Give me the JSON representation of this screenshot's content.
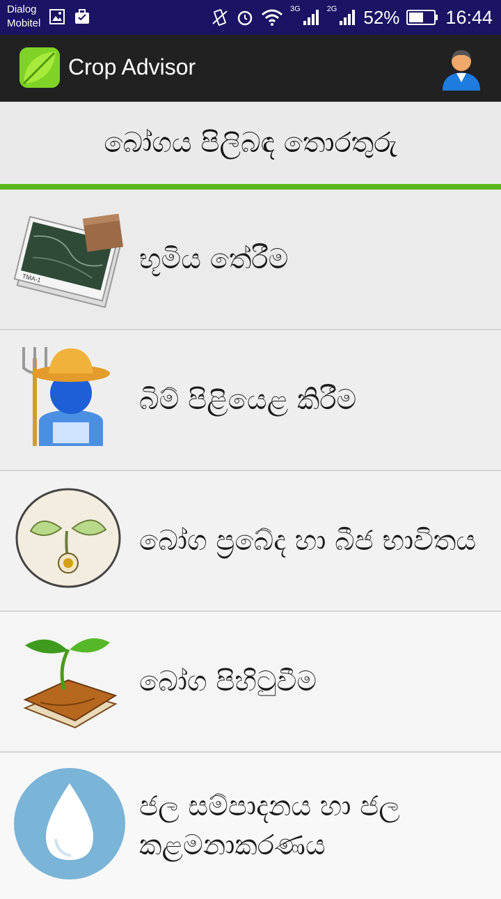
{
  "status_bar": {
    "carrier_line1": "Dialog",
    "carrier_line2": "Mobitel",
    "net1": "3G",
    "net2": "2G",
    "battery": "52%",
    "time": "16:44"
  },
  "app_bar": {
    "title": "Crop Advisor",
    "accent": "#6fc21f"
  },
  "section": {
    "title": "බෝගය පිලිබඳ තොරතුරු",
    "rule_color": "#5cb81a"
  },
  "menu": {
    "items": [
      {
        "label": "භූමිය තේරීම",
        "icon": "soil-sample-icon"
      },
      {
        "label": "බිම් පිළියෙළ කිරීම",
        "icon": "farmer-icon"
      },
      {
        "label": "බෝග ප්‍රබේද හා බීජ භාවිතය",
        "icon": "seedling-icon"
      },
      {
        "label": "බෝග පිහිටුවීම",
        "icon": "plant-book-icon"
      },
      {
        "label": "ජල සම්පාදනය හා ජල කළමනාකරණය",
        "icon": "water-drop-icon"
      }
    ]
  }
}
